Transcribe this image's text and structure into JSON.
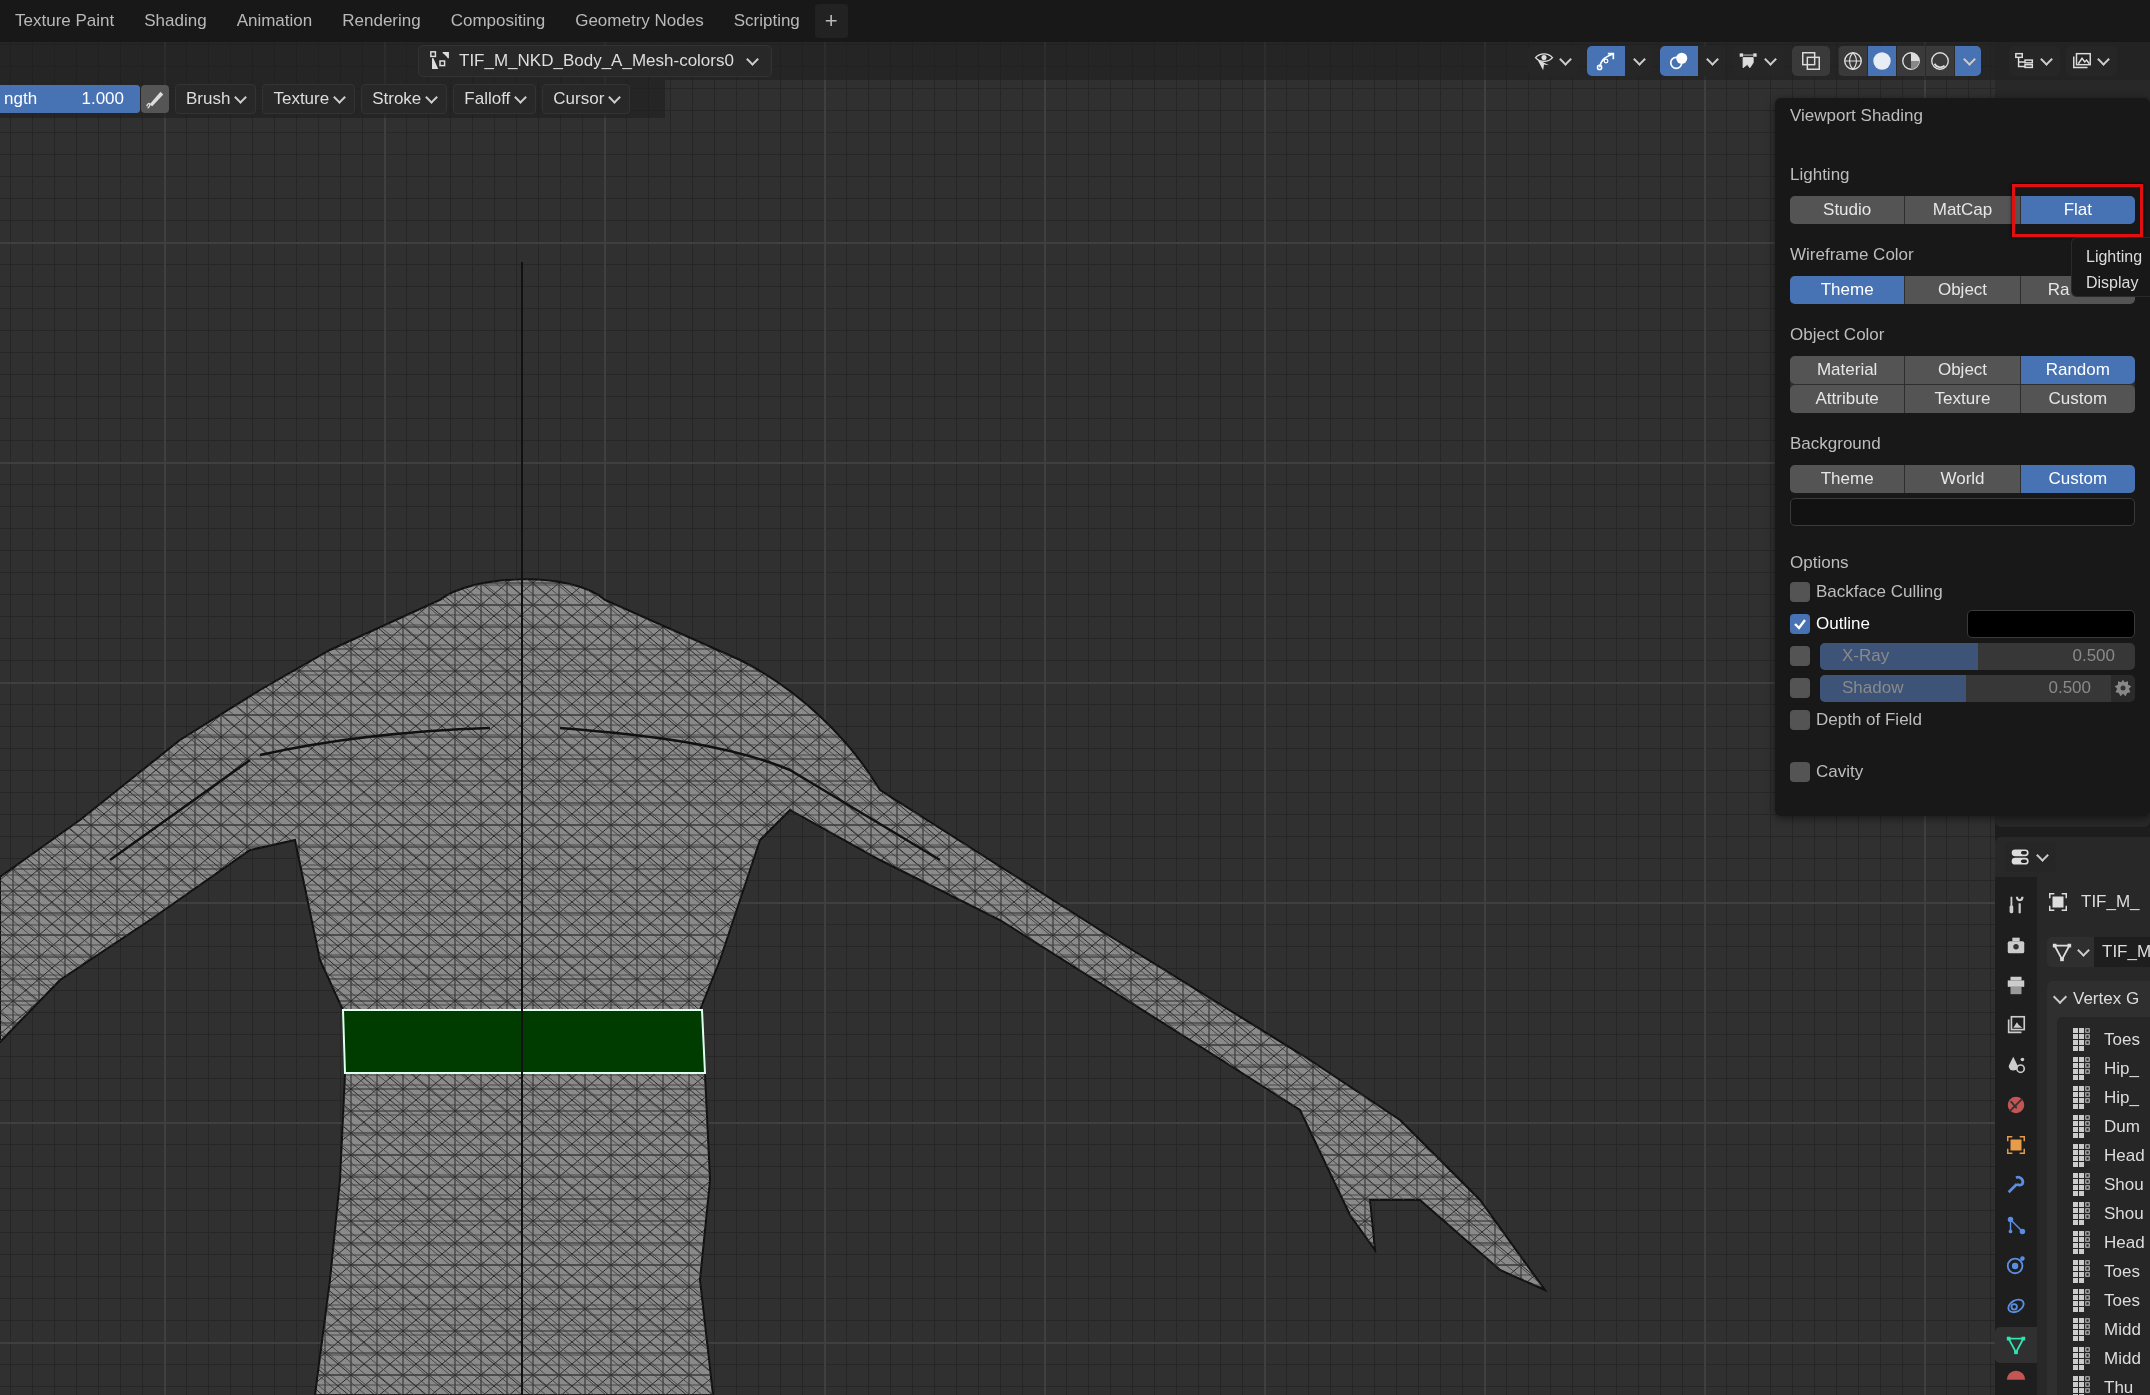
{
  "workspace_tabs": [
    {
      "label": "Texture Paint"
    },
    {
      "label": "Shading"
    },
    {
      "label": "Animation"
    },
    {
      "label": "Rendering"
    },
    {
      "label": "Compositing"
    },
    {
      "label": "Geometry Nodes"
    },
    {
      "label": "Scripting"
    }
  ],
  "add_tab": "+",
  "header": {
    "mesh_selector": "TIF_M_NKD_Body_A_Mesh-colors0",
    "gizmos": {
      "on": true
    },
    "overlays": {
      "on": true
    },
    "xray": {
      "on": false
    },
    "shading_modes": [
      {
        "kind": "wireframe",
        "selected": false
      },
      {
        "kind": "solid",
        "selected": true
      },
      {
        "kind": "material",
        "selected": false
      },
      {
        "kind": "rendered",
        "selected": false
      }
    ]
  },
  "tool_settings": {
    "strength": {
      "label": "ngth",
      "value": "1.000",
      "level": 1
    },
    "menus": [
      "Brush",
      "Texture",
      "Stroke",
      "Falloff",
      "Cursor"
    ]
  },
  "viewport_shading": {
    "title": "Viewport Shading",
    "sections": [
      {
        "label": "Lighting",
        "options": [
          {
            "label": "Studio",
            "selected": false
          },
          {
            "label": "MatCap",
            "selected": false
          },
          {
            "label": "Flat",
            "selected": true,
            "annotated": true
          }
        ]
      },
      {
        "label": "Wireframe Color",
        "options": [
          {
            "label": "Theme",
            "selected": true
          },
          {
            "label": "Object",
            "selected": false
          },
          {
            "label": "Ra",
            "selected": false,
            "covered": true
          }
        ]
      },
      {
        "label": "Object Color",
        "options": [
          {
            "label": "Material",
            "selected": false
          },
          {
            "label": "Object",
            "selected": false
          },
          {
            "label": "Random",
            "selected": true
          },
          {
            "label": "Attribute",
            "selected": false
          },
          {
            "label": "Texture",
            "selected": false
          },
          {
            "label": "Custom",
            "selected": false
          }
        ]
      },
      {
        "label": "Background",
        "color": "#121212",
        "options": [
          {
            "label": "Theme",
            "selected": false
          },
          {
            "label": "World",
            "selected": false
          },
          {
            "label": "Custom",
            "selected": true
          }
        ]
      }
    ],
    "options_label": "Options",
    "options": [
      {
        "kind": "checkbox",
        "label": "Backface Culling",
        "checked": false
      },
      {
        "kind": "checkbox_color",
        "label": "Outline",
        "checked": true,
        "color": "#000000"
      },
      {
        "kind": "checkbox_slider",
        "label": "X-Ray",
        "checked": false,
        "value": "0.500",
        "level": 0.5
      },
      {
        "kind": "checkbox_slider_gear",
        "label": "Shadow",
        "checked": false,
        "value": "0.500",
        "level": 0.5
      },
      {
        "kind": "checkbox",
        "label": "Depth of Field",
        "checked": false
      },
      {
        "kind": "checkbox",
        "label": "Cavity",
        "checked": false
      }
    ]
  },
  "tooltip": {
    "lines": [
      "Lighting",
      "Display"
    ]
  },
  "properties": {
    "object_name": "TIF_M_",
    "data_name": "TIF_M",
    "tabs": [
      {
        "kind": "tool",
        "selected": false
      },
      {
        "kind": "render",
        "selected": false
      },
      {
        "kind": "output",
        "selected": false
      },
      {
        "kind": "view_layer",
        "selected": false
      },
      {
        "kind": "scene",
        "selected": false
      },
      {
        "kind": "world",
        "selected": false
      },
      {
        "kind": "object",
        "selected": false
      },
      {
        "kind": "modifiers",
        "selected": false
      },
      {
        "kind": "particles",
        "selected": false
      },
      {
        "kind": "physics",
        "selected": false
      },
      {
        "kind": "constraints",
        "selected": false
      },
      {
        "kind": "data",
        "selected": true
      },
      {
        "kind": "material",
        "selected": false
      }
    ],
    "panel": {
      "title": "Vertex G",
      "expanded": true,
      "groups": [
        "Toes",
        "Hip_",
        "Hip_",
        "Dum",
        "Head",
        "Shou",
        "Shou",
        "Head",
        "Toes",
        "Toes",
        "Midd",
        "Midd",
        "Thu"
      ]
    }
  }
}
